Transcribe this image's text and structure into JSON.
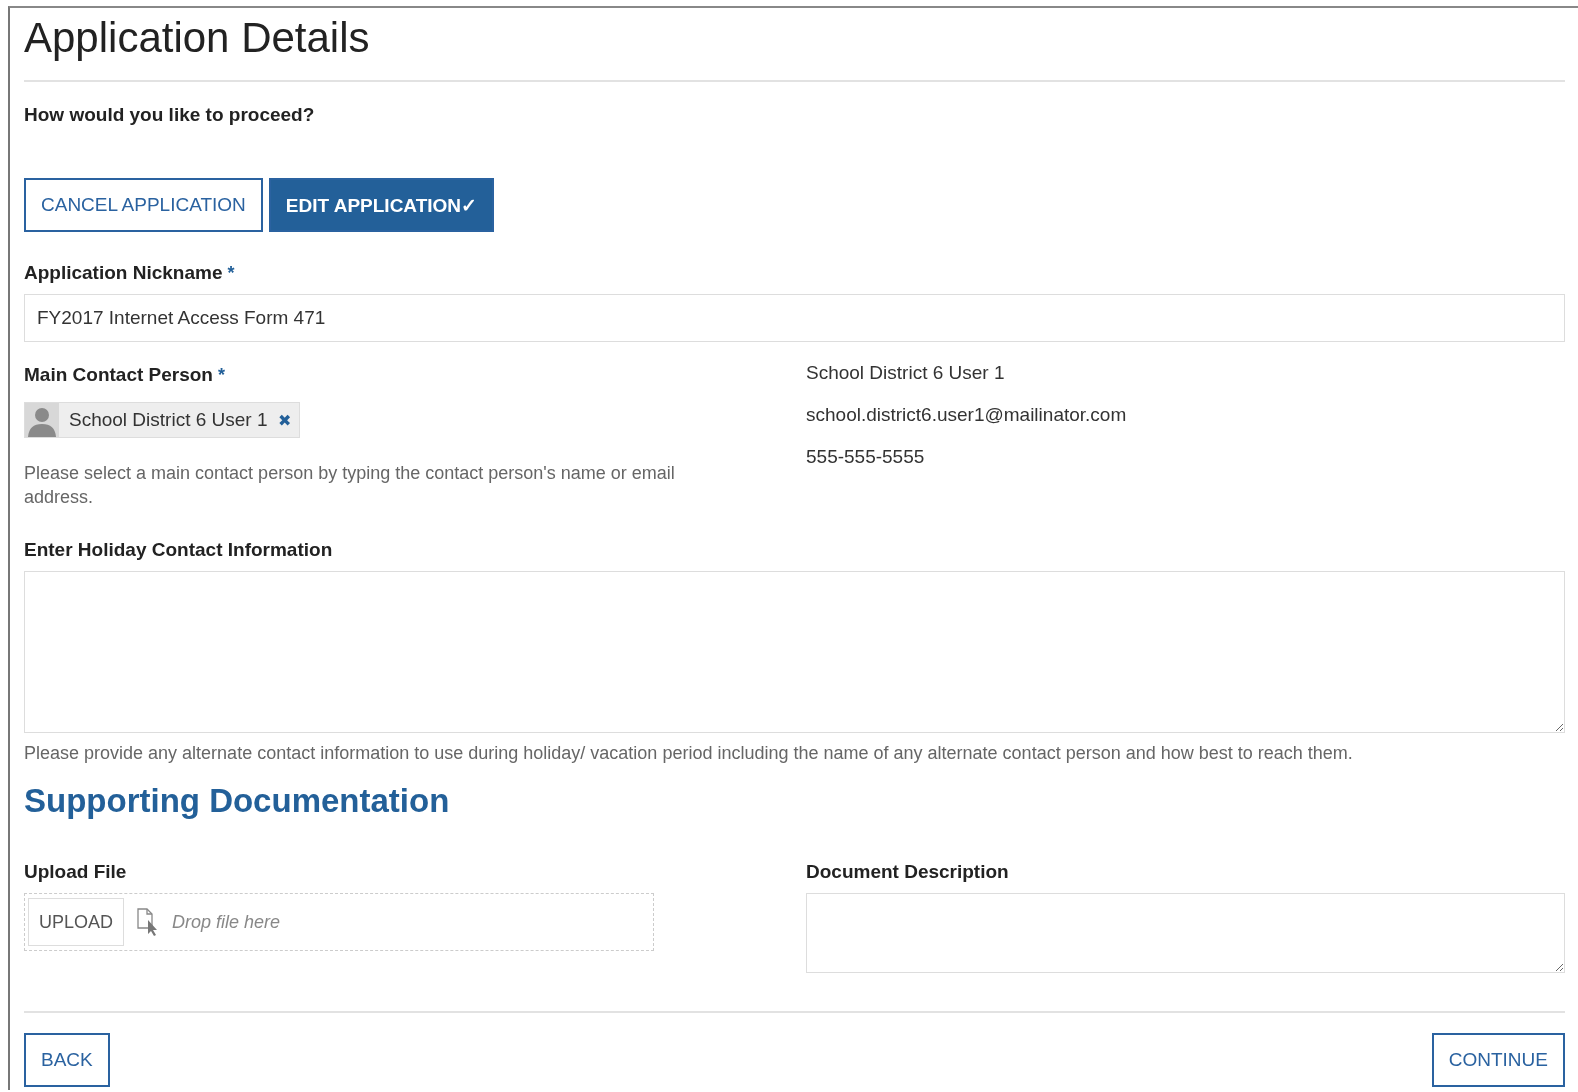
{
  "title": "Application Details",
  "question": "How would you like to proceed?",
  "choices": [
    {
      "label": "CANCEL APPLICATION",
      "selected": false
    },
    {
      "label": "EDIT APPLICATION✓",
      "selected": true
    }
  ],
  "nickname": {
    "label": "Application Nickname",
    "required_mark": "*",
    "value": "FY2017 Internet Access Form 471"
  },
  "main_contact": {
    "label": "Main Contact Person",
    "required_mark": "*",
    "chip": "School District 6 User 1",
    "remove": "✖",
    "help": "Please select a main contact person by typing the contact person's name or email address.",
    "details": [
      "School District 6 User 1",
      "school.district6.user1@mailinator.com",
      "555-555-5555"
    ]
  },
  "holiday": {
    "label": "Enter Holiday Contact Information",
    "help": "Please provide any alternate contact information to use during holiday/ vacation period including the name of any alternate contact person and how best to reach them."
  },
  "supporting": {
    "heading": "Supporting Documentation",
    "upload_label": "Upload File",
    "upload_button": "UPLOAD",
    "drop_placeholder": "Drop file here",
    "description_label": "Document Description"
  },
  "footer": {
    "back": "BACK",
    "continue": "CONTINUE"
  }
}
